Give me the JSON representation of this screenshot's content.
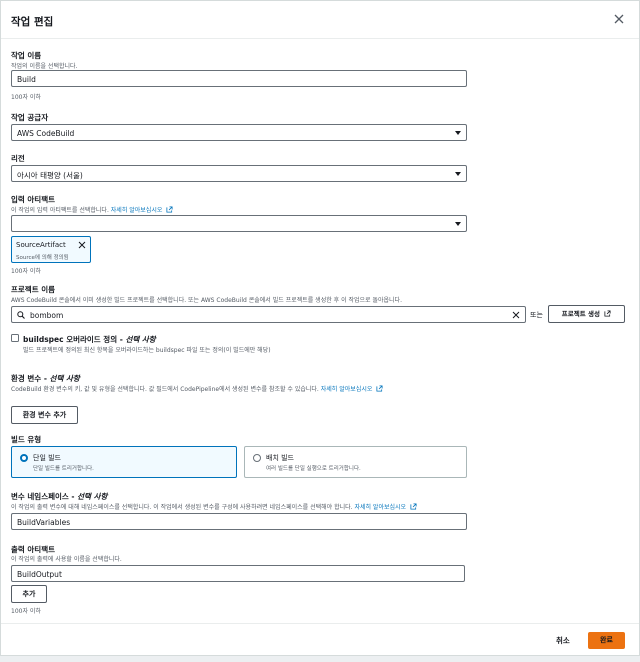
{
  "modal": {
    "title": "작업 편집"
  },
  "action_name": {
    "label": "작업 이름",
    "description": "작업의 이름을 선택합니다.",
    "value": "Build",
    "hint": "100자 이하"
  },
  "action_provider": {
    "label": "작업 공급자",
    "value": "AWS CodeBuild"
  },
  "region": {
    "label": "리전",
    "value": "아시아 태평양 (서울)"
  },
  "input_artifacts": {
    "label": "입력 아티팩트",
    "description": "이 작업의 입력 아티팩트를 선택합니다.",
    "learn_more": "자세히 알아보십시오",
    "select_value": "",
    "token": {
      "title": "SourceArtifact",
      "subtitle": "Source에 의해 정의됨"
    },
    "hint": "100자 이하"
  },
  "project_name": {
    "label": "프로젝트 이름",
    "description": "AWS CodeBuild 콘솔에서 이미 생성한 빌드 프로젝트를 선택합니다. 또는 AWS CodeBuild 콘솔에서 빌드 프로젝트를 생성한 후 이 작업으로 돌아옵니다.",
    "value": "bombom",
    "or_text": "또는",
    "create_button": "프로젝트 생성"
  },
  "buildspec_override": {
    "label": "buildspec 오버라이드 정의 - ",
    "label_optional": "선택 사항",
    "description": "빌드 프로젝트에 정의된 최신 항목을 오버라이드하는 buildspec 파일 또는 정의(이 빌드에만 해당)"
  },
  "env_vars": {
    "label": "환경 변수 - ",
    "label_optional": "선택 사항",
    "description": "CodeBuild 환경 변수의 키, 값 및 유형을 선택합니다. 값 필드에서 CodePipeline에서 생성된 변수를 참조할 수 있습니다.",
    "learn_more": "자세히 알아보십시오",
    "add_button": "환경 변수 추가"
  },
  "build_type": {
    "label": "빌드 유형",
    "options": [
      {
        "title": "단일 빌드",
        "subtitle": "단일 빌드를 트리거합니다.",
        "selected": true
      },
      {
        "title": "배치 빌드",
        "subtitle": "여러 빌드를 단일 실행으로 트리거합니다.",
        "selected": false
      }
    ]
  },
  "variable_namespace": {
    "label": "변수 네임스페이스 - ",
    "label_optional": "선택 사항",
    "description": "이 작업의 출력 변수에 대해 네임스페이스를 선택합니다. 이 작업에서 생성된 변수를 구성에 사용하려면 네임스페이스를 선택해야 합니다.",
    "learn_more": "자세히 알아보십시오",
    "value": "BuildVariables"
  },
  "output_artifacts": {
    "label": "출력 아티팩트",
    "description": "이 작업의 출력에 사용할 이름을 선택합니다.",
    "value": "BuildOutput",
    "add_button": "추가",
    "hint": "100자 이하"
  },
  "footer": {
    "cancel": "취소",
    "done": "완료"
  },
  "colors": {
    "accent": "#0073bb",
    "primary_button": "#ec7211",
    "border": "#687078"
  }
}
